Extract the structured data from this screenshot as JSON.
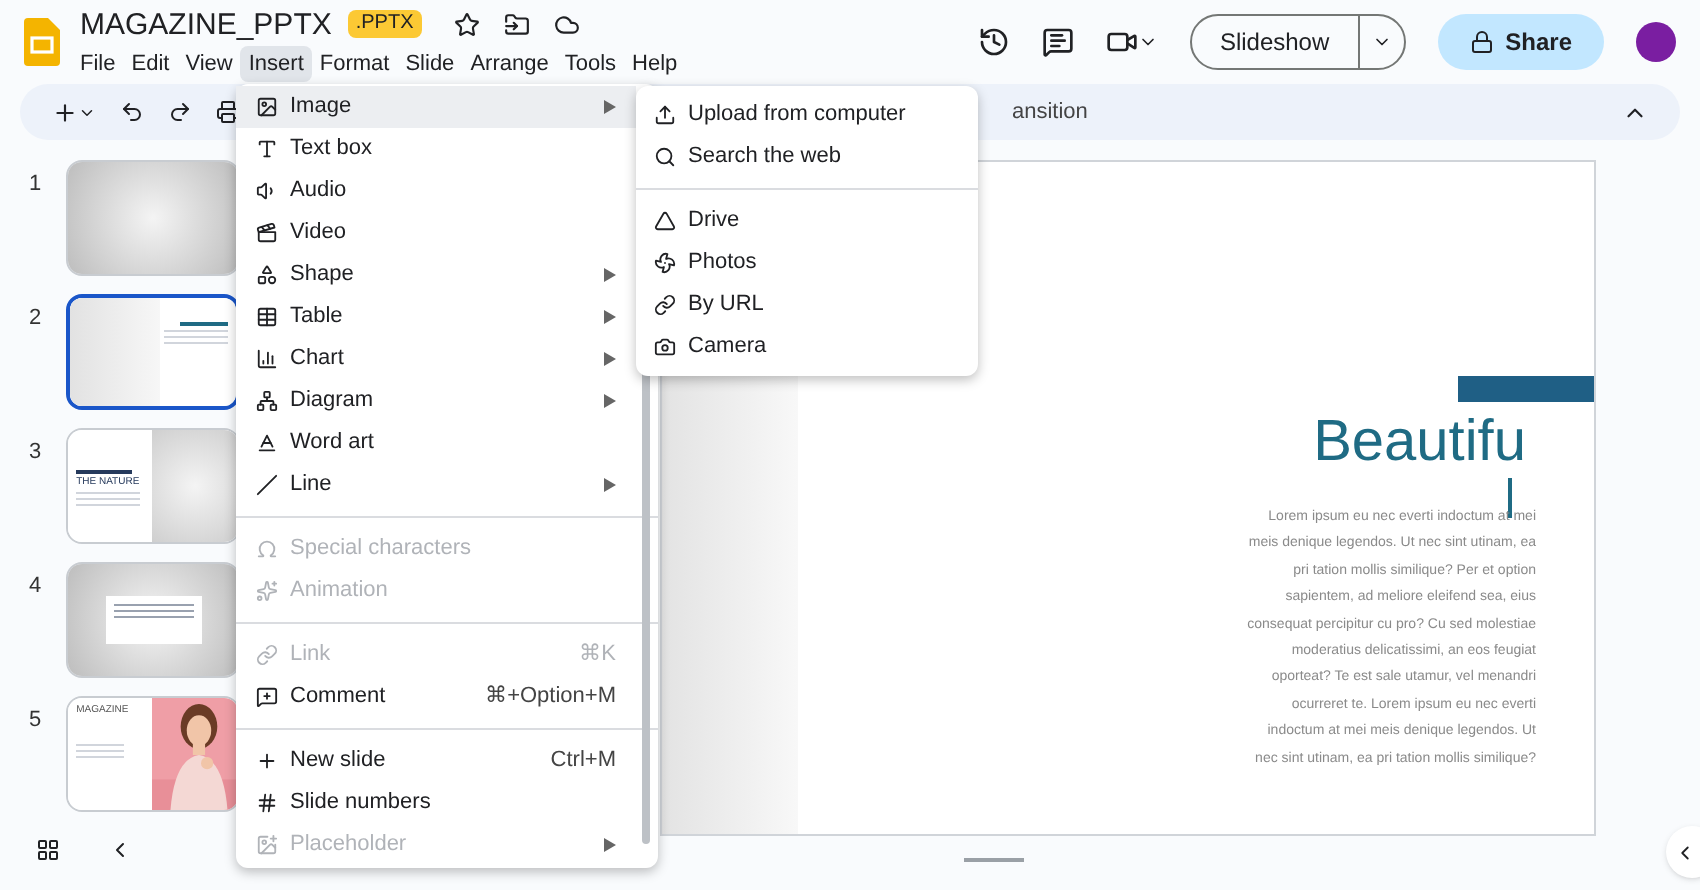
{
  "document": {
    "title": "MAGAZINE_PPTX",
    "badge": ".PPTX"
  },
  "menubar": [
    {
      "label": "File",
      "selected": false
    },
    {
      "label": "Edit",
      "selected": false
    },
    {
      "label": "View",
      "selected": false
    },
    {
      "label": "Insert",
      "selected": true
    },
    {
      "label": "Format",
      "selected": false
    },
    {
      "label": "Slide",
      "selected": false
    },
    {
      "label": "Arrange",
      "selected": false
    },
    {
      "label": "Tools",
      "selected": false
    },
    {
      "label": "Help",
      "selected": false
    }
  ],
  "actions": {
    "slideshow": "Slideshow",
    "share": "Share"
  },
  "toolbar": {
    "visible_text": "ansition"
  },
  "filmstrip": [
    {
      "number": "1",
      "selected": false,
      "kind": "blank"
    },
    {
      "number": "2",
      "selected": true,
      "kind": "split"
    },
    {
      "number": "3",
      "selected": false,
      "kind": "nature",
      "heading": "THE NATURE"
    },
    {
      "number": "4",
      "selected": false,
      "kind": "textbox"
    },
    {
      "number": "5",
      "selected": false,
      "heading": "MAGAZINE"
    }
  ],
  "insert_menu": [
    {
      "kind": "item",
      "label": "Image",
      "submenu": true,
      "disabled": false,
      "selected": true
    },
    {
      "kind": "item",
      "label": "Text box",
      "submenu": false,
      "disabled": false,
      "selected": false
    },
    {
      "kind": "item",
      "label": "Audio",
      "submenu": false,
      "disabled": false,
      "selected": false
    },
    {
      "kind": "item",
      "label": "Video",
      "submenu": false,
      "disabled": false,
      "selected": false
    },
    {
      "kind": "item",
      "label": "Shape",
      "submenu": true,
      "disabled": false,
      "selected": false
    },
    {
      "kind": "item",
      "label": "Table",
      "submenu": true,
      "disabled": false,
      "selected": false
    },
    {
      "kind": "item",
      "label": "Chart",
      "submenu": true,
      "disabled": false,
      "selected": false
    },
    {
      "kind": "item",
      "label": "Diagram",
      "submenu": true,
      "disabled": false,
      "selected": false
    },
    {
      "kind": "item",
      "label": "Word art",
      "submenu": false,
      "disabled": false,
      "selected": false
    },
    {
      "kind": "item",
      "label": "Line",
      "submenu": true,
      "disabled": false,
      "selected": false
    },
    {
      "kind": "divider"
    },
    {
      "kind": "item",
      "label": "Special characters",
      "submenu": false,
      "disabled": true,
      "selected": false
    },
    {
      "kind": "item",
      "label": "Animation",
      "submenu": false,
      "disabled": true,
      "selected": false
    },
    {
      "kind": "divider"
    },
    {
      "kind": "item",
      "label": "Link",
      "shortcut": "⌘K",
      "submenu": false,
      "disabled": true,
      "selected": false
    },
    {
      "kind": "item",
      "label": "Comment",
      "shortcut": "⌘+Option+M",
      "submenu": false,
      "disabled": false,
      "selected": false
    },
    {
      "kind": "divider"
    },
    {
      "kind": "item",
      "label": "New slide",
      "shortcut": "Ctrl+M",
      "submenu": false,
      "disabled": false,
      "selected": false
    },
    {
      "kind": "item",
      "label": "Slide numbers",
      "submenu": false,
      "disabled": false,
      "selected": false
    },
    {
      "kind": "item",
      "label": "Placeholder",
      "submenu": true,
      "disabled": true,
      "selected": false
    }
  ],
  "image_submenu": [
    {
      "kind": "item",
      "label": "Upload from computer"
    },
    {
      "kind": "item",
      "label": "Search the web"
    },
    {
      "kind": "divider"
    },
    {
      "kind": "item",
      "label": "Drive"
    },
    {
      "kind": "item",
      "label": "Photos"
    },
    {
      "kind": "item",
      "label": "By URL"
    },
    {
      "kind": "item",
      "label": "Camera"
    }
  ],
  "slide": {
    "title": "Beautifu",
    "body_lines": [
      "Lorem ipsum eu nec everti indoctum at mei",
      "meis denique legendos. Ut nec sint utinam, ea",
      "pri tation mollis similique? Per et option",
      "sapientem, ad meliore eleifend sea, eius",
      "consequat percipitur cu pro? Cu sed molestiae",
      "moderatius delicatissimi, an eos feugiat",
      "oporteat? Te est sale utamur, vel menandri",
      "ocurreret te. Lorem ipsum eu nec everti",
      "indoctum at mei meis denique legendos. Ut",
      "nec sint utinam, ea pri tation mollis similique?"
    ]
  }
}
